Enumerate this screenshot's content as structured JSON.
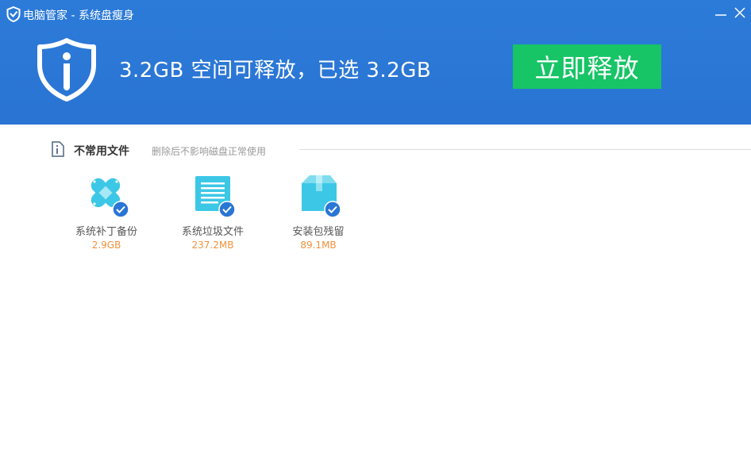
{
  "window": {
    "title": "电脑管家 - 系统盘瘦身"
  },
  "header": {
    "headline": "3.2GB 空间可释放，已选 3.2GB",
    "release_button": "立即释放"
  },
  "section": {
    "title": "不常用文件",
    "description": "删除后不影响磁盘正常使用"
  },
  "items": [
    {
      "name": "系统补丁备份",
      "size": "2.9GB",
      "icon": "bandage-icon",
      "checked": true
    },
    {
      "name": "系统垃圾文件",
      "size": "237.2MB",
      "icon": "document-list-icon",
      "checked": true
    },
    {
      "name": "安装包残留",
      "size": "89.1MB",
      "icon": "package-box-icon",
      "checked": true
    }
  ],
  "colors": {
    "header_blue": "#2a76d5",
    "release_green": "#17c466",
    "icon_cyan": "#3cc7e6",
    "check_blue": "#2a76d5",
    "size_orange": "#f0913b"
  }
}
